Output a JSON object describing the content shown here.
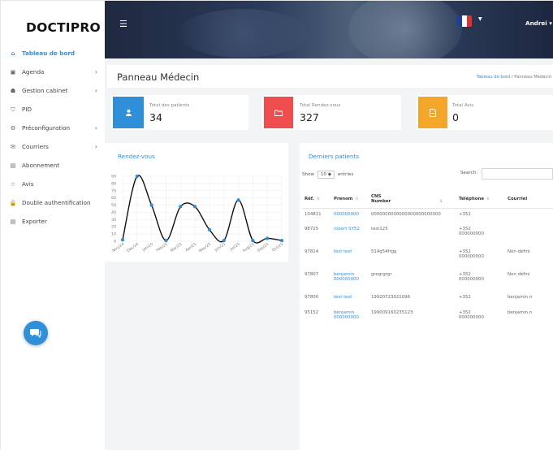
{
  "app": {
    "logo": "DOCTIPRO",
    "user": "Andrei"
  },
  "sidebar": {
    "items": [
      {
        "label": "Tableau de bord",
        "icon": "home-icon",
        "active": true,
        "chevron": false
      },
      {
        "label": "Agenda",
        "icon": "calendar-icon",
        "active": false,
        "chevron": true
      },
      {
        "label": "Gestion cabinet",
        "icon": "users-icon",
        "active": false,
        "chevron": true
      },
      {
        "label": "PID",
        "icon": "pid-icon",
        "active": false,
        "chevron": false
      },
      {
        "label": "Préconfiguration",
        "icon": "gears-icon",
        "active": false,
        "chevron": true
      },
      {
        "label": "Courriers",
        "icon": "envelope-icon",
        "active": false,
        "chevron": true
      },
      {
        "label": "Abonnement",
        "icon": "document-icon",
        "active": false,
        "chevron": false
      },
      {
        "label": "Avis",
        "icon": "star-icon",
        "active": false,
        "chevron": false
      },
      {
        "label": "Double authentification",
        "icon": "lock-icon",
        "active": false,
        "chevron": false
      },
      {
        "label": "Exporter",
        "icon": "document-icon",
        "active": false,
        "chevron": false
      }
    ]
  },
  "header": {
    "title": "Panneau Médecin",
    "breadcrumb_link": "Tableau de bord",
    "breadcrumb_sep": "/",
    "breadcrumb_current": "Panneau Médecin"
  },
  "stats": [
    {
      "label": "Total des patients",
      "value": "34",
      "color": "#2f8fd8",
      "icon": "user-icon"
    },
    {
      "label": "Total Rendez-vous",
      "value": "327",
      "color": "#ef4d4d",
      "icon": "folder-icon"
    },
    {
      "label": "Total Avis",
      "value": "0",
      "color": "#f4a62a",
      "icon": "file-icon"
    }
  ],
  "chart_card": {
    "title": "Rendez-vous"
  },
  "chart_data": {
    "type": "line",
    "x": [
      "Nov/24",
      "Dec/24",
      "Jan/25",
      "Feb/25",
      "Mar/25",
      "Apr/25",
      "May/25",
      "Jun/25",
      "Jul/25",
      "Aug/25",
      "Sep/25",
      "Oct/25"
    ],
    "series": [
      {
        "values": [
          2,
          90,
          50,
          1,
          48,
          48,
          16,
          1,
          57,
          1,
          4,
          1
        ]
      }
    ],
    "yticks": [
      "0",
      "10",
      "20",
      "30",
      "40",
      "50",
      "60",
      "70",
      "80",
      "90"
    ],
    "ylim": [
      0,
      90
    ],
    "grid": true
  },
  "patients": {
    "title": "Derniers patients",
    "show_label": "Show",
    "entries_value": "10 ◆",
    "entries_label": "entries",
    "search_label": "Search:",
    "columns": [
      "Réf.",
      "Prénom",
      "CNS Number",
      "Téléphone",
      "Courriel"
    ],
    "rows": [
      {
        "ref": "104811",
        "prenom": "000000000",
        "cns": "0000000000000000000000000",
        "tel": "+352",
        "tel2": "",
        "email": ""
      },
      {
        "ref": "98725",
        "prenom": "robert SY52",
        "cns": "test125",
        "tel": "+352",
        "tel2": "000000000",
        "email": ""
      },
      {
        "ref": "97814",
        "prenom": "test test",
        "cns": "514g54frgg",
        "tel": "+352",
        "tel2": "000000000",
        "email": "Non défini"
      },
      {
        "ref": "97807",
        "prenom": "benjamin",
        "prenom2": "000000000",
        "cns": "gregrgrgr",
        "tel": "+352",
        "tel2": "000000000",
        "email": "Non défini"
      },
      {
        "ref": "97800",
        "prenom": "test test",
        "cns": "19920723021096",
        "tel": "+352",
        "tel2": "",
        "email": "benjamin.n"
      },
      {
        "ref": "95152",
        "prenom": "benjamin",
        "prenom2": "000000000",
        "cns": "19900916023512З",
        "tel": "+352",
        "tel2": "000000000",
        "email": "benjamin.n"
      }
    ]
  }
}
